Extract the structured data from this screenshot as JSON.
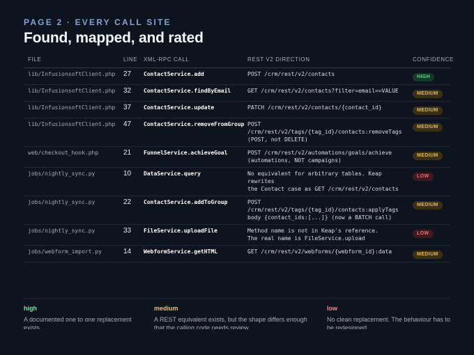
{
  "header": {
    "eyebrow": "PAGE 2 · EVERY CALL SITE",
    "title": "Found, mapped, and rated"
  },
  "table": {
    "columns": [
      "FILE",
      "LINE",
      "XML-RPC CALL",
      "REST V2 DIRECTION",
      "CONFIDENCE"
    ],
    "rows": [
      {
        "file": "lib/InfusionsoftClient.php",
        "line": "27",
        "call": "ContactService.add",
        "rest": "POST /crm/rest/v2/contacts",
        "confidence": "HIGH",
        "level": "high"
      },
      {
        "file": "lib/InfusionsoftClient.php",
        "line": "32",
        "call": "ContactService.findByEmail",
        "rest": "GET /crm/rest/v2/contacts?filter=email==VALUE",
        "confidence": "MEDIUM",
        "level": "medium"
      },
      {
        "file": "lib/InfusionsoftClient.php",
        "line": "37",
        "call": "ContactService.update",
        "rest": "PATCH /crm/rest/v2/contacts/{contact_id}",
        "confidence": "MEDIUM",
        "level": "medium"
      },
      {
        "file": "lib/InfusionsoftClient.php",
        "line": "47",
        "call": "ContactService.removeFromGroup",
        "rest": "POST\n/crm/rest/v2/tags/{tag_id}/contacts:removeTags\n(POST, not DELETE)",
        "confidence": "MEDIUM",
        "level": "medium"
      },
      {
        "file": "web/checkout_hook.php",
        "line": "21",
        "call": "FunnelService.achieveGoal",
        "rest": "POST /crm/rest/v2/automations/goals/achieve\n(automations, NOT campaigns)",
        "confidence": "MEDIUM",
        "level": "medium"
      },
      {
        "file": "jobs/nightly_sync.py",
        "line": "10",
        "call": "DataService.query",
        "rest": "No equivalent for arbitrary tables. Keap rewrites\nthe Contact case as GET /crm/rest/v2/contacts",
        "confidence": "LOW",
        "level": "low"
      },
      {
        "file": "jobs/nightly_sync.py",
        "line": "22",
        "call": "ContactService.addToGroup",
        "rest": "POST\n/crm/rest/v2/tags/{tag_id}/contacts:applyTags\nbody {contact_ids:[...]} (now a BATCH call)",
        "confidence": "MEDIUM",
        "level": "medium"
      },
      {
        "file": "jobs/nightly_sync.py",
        "line": "33",
        "call": "FileService.uploadFile",
        "rest": "Method name is not in Keap's reference.\nThe real name is FileService.upload",
        "confidence": "LOW",
        "level": "low"
      },
      {
        "file": "jobs/webform_import.py",
        "line": "14",
        "call": "WebformService.getHTML",
        "rest": "GET /crm/rest/v2/webforms/{webform_id}:data",
        "confidence": "MEDIUM",
        "level": "medium"
      }
    ]
  },
  "legend": {
    "high": {
      "term": "high",
      "desc": "A documented one to one replacement exists."
    },
    "medium": {
      "term": "medium",
      "desc": "A REST equivalent exists, but the shape differs enough that the calling code needs review."
    },
    "low": {
      "term": "low",
      "desc": "No clean replacement. The behaviour has to be redesigned."
    }
  },
  "colors": {
    "background": "#0e141d",
    "accent": "#7ea6d8",
    "high": "#4ade80",
    "medium": "#e5b84a",
    "low": "#f27373"
  }
}
